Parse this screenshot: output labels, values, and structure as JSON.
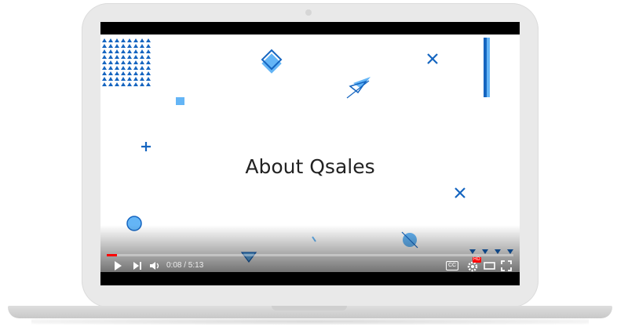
{
  "video": {
    "title": "About Qsales",
    "time": "0:08 / 5:13",
    "progress": 0.026,
    "cc_label": "CC",
    "hd_badge": "HD"
  },
  "colors": {
    "accent_blue": "#1565c0",
    "light_blue": "#64b5f6",
    "progress_red": "#ff0000"
  },
  "icons": [
    "play-icon",
    "next-icon",
    "volume-icon",
    "captions-icon",
    "settings-icon",
    "theater-icon",
    "fullscreen-icon"
  ]
}
